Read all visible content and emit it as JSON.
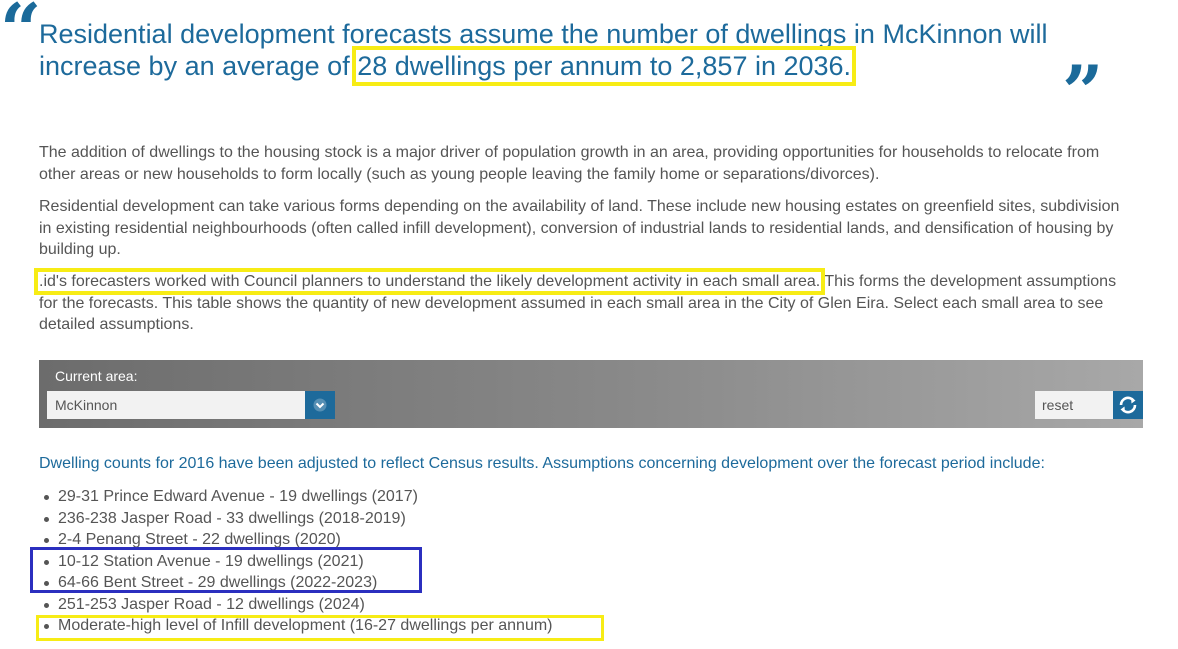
{
  "headline": {
    "open_quote": "“",
    "close_quote": "”",
    "text_before": "Residential development forecasts assume the number of dwellings in McKinnon will increase by an average of ",
    "text_highlight": "28 dwellings per annum to 2,857 in 2036."
  },
  "paragraphs": {
    "p1": "The addition of dwellings to the housing stock is a major driver of population growth in an area, providing opportunities for households to relocate from other areas or new households to form locally (such as young people leaving the family home or separations/divorces).",
    "p2": "Residential development can take various forms depending on the availability of land. These include new housing estates on greenfield sites, subdivision in existing residential neighbourhoods (often called infill development), conversion of industrial lands to residential lands, and densification of housing by building up.",
    "p3_highlight": ".id's forecasters worked with Council planners to understand the likely development activity in each small area.",
    "p3_rest": " This forms the development assumptions for the forecasts. This table shows the quantity of new development assumed in each small area in the City of Glen Eira. Select each small area to see detailed assumptions."
  },
  "area_selector": {
    "label": "Current area:",
    "value": "McKinnon",
    "reset_label": "reset"
  },
  "dwelling_note": "Dwelling counts for 2016 have been adjusted to reflect Census results. Assumptions concerning development over the forecast period include:",
  "assumptions": [
    "29-31 Prince Edward Avenue - 19 dwellings (2017)",
    "236-238 Jasper Road - 33 dwellings (2018-2019)",
    "2-4 Penang Street - 22 dwellings (2020)",
    "10-12 Station Avenue - 19 dwellings (2021)",
    "64-66 Bent Street - 29 dwellings (2022-2023)",
    "251-253 Jasper Road - 12 dwellings (2024)",
    "Moderate-high level of Infill development (16-27 dwellings per annum)"
  ],
  "colors": {
    "heading_blue": "#1d6a9b",
    "highlight_yellow": "#f7ec15",
    "highlight_blue": "#2b2fbf",
    "body_text": "#555555"
  },
  "icons": {
    "dropdown": "chevron-down-icon",
    "reset": "refresh-icon"
  }
}
